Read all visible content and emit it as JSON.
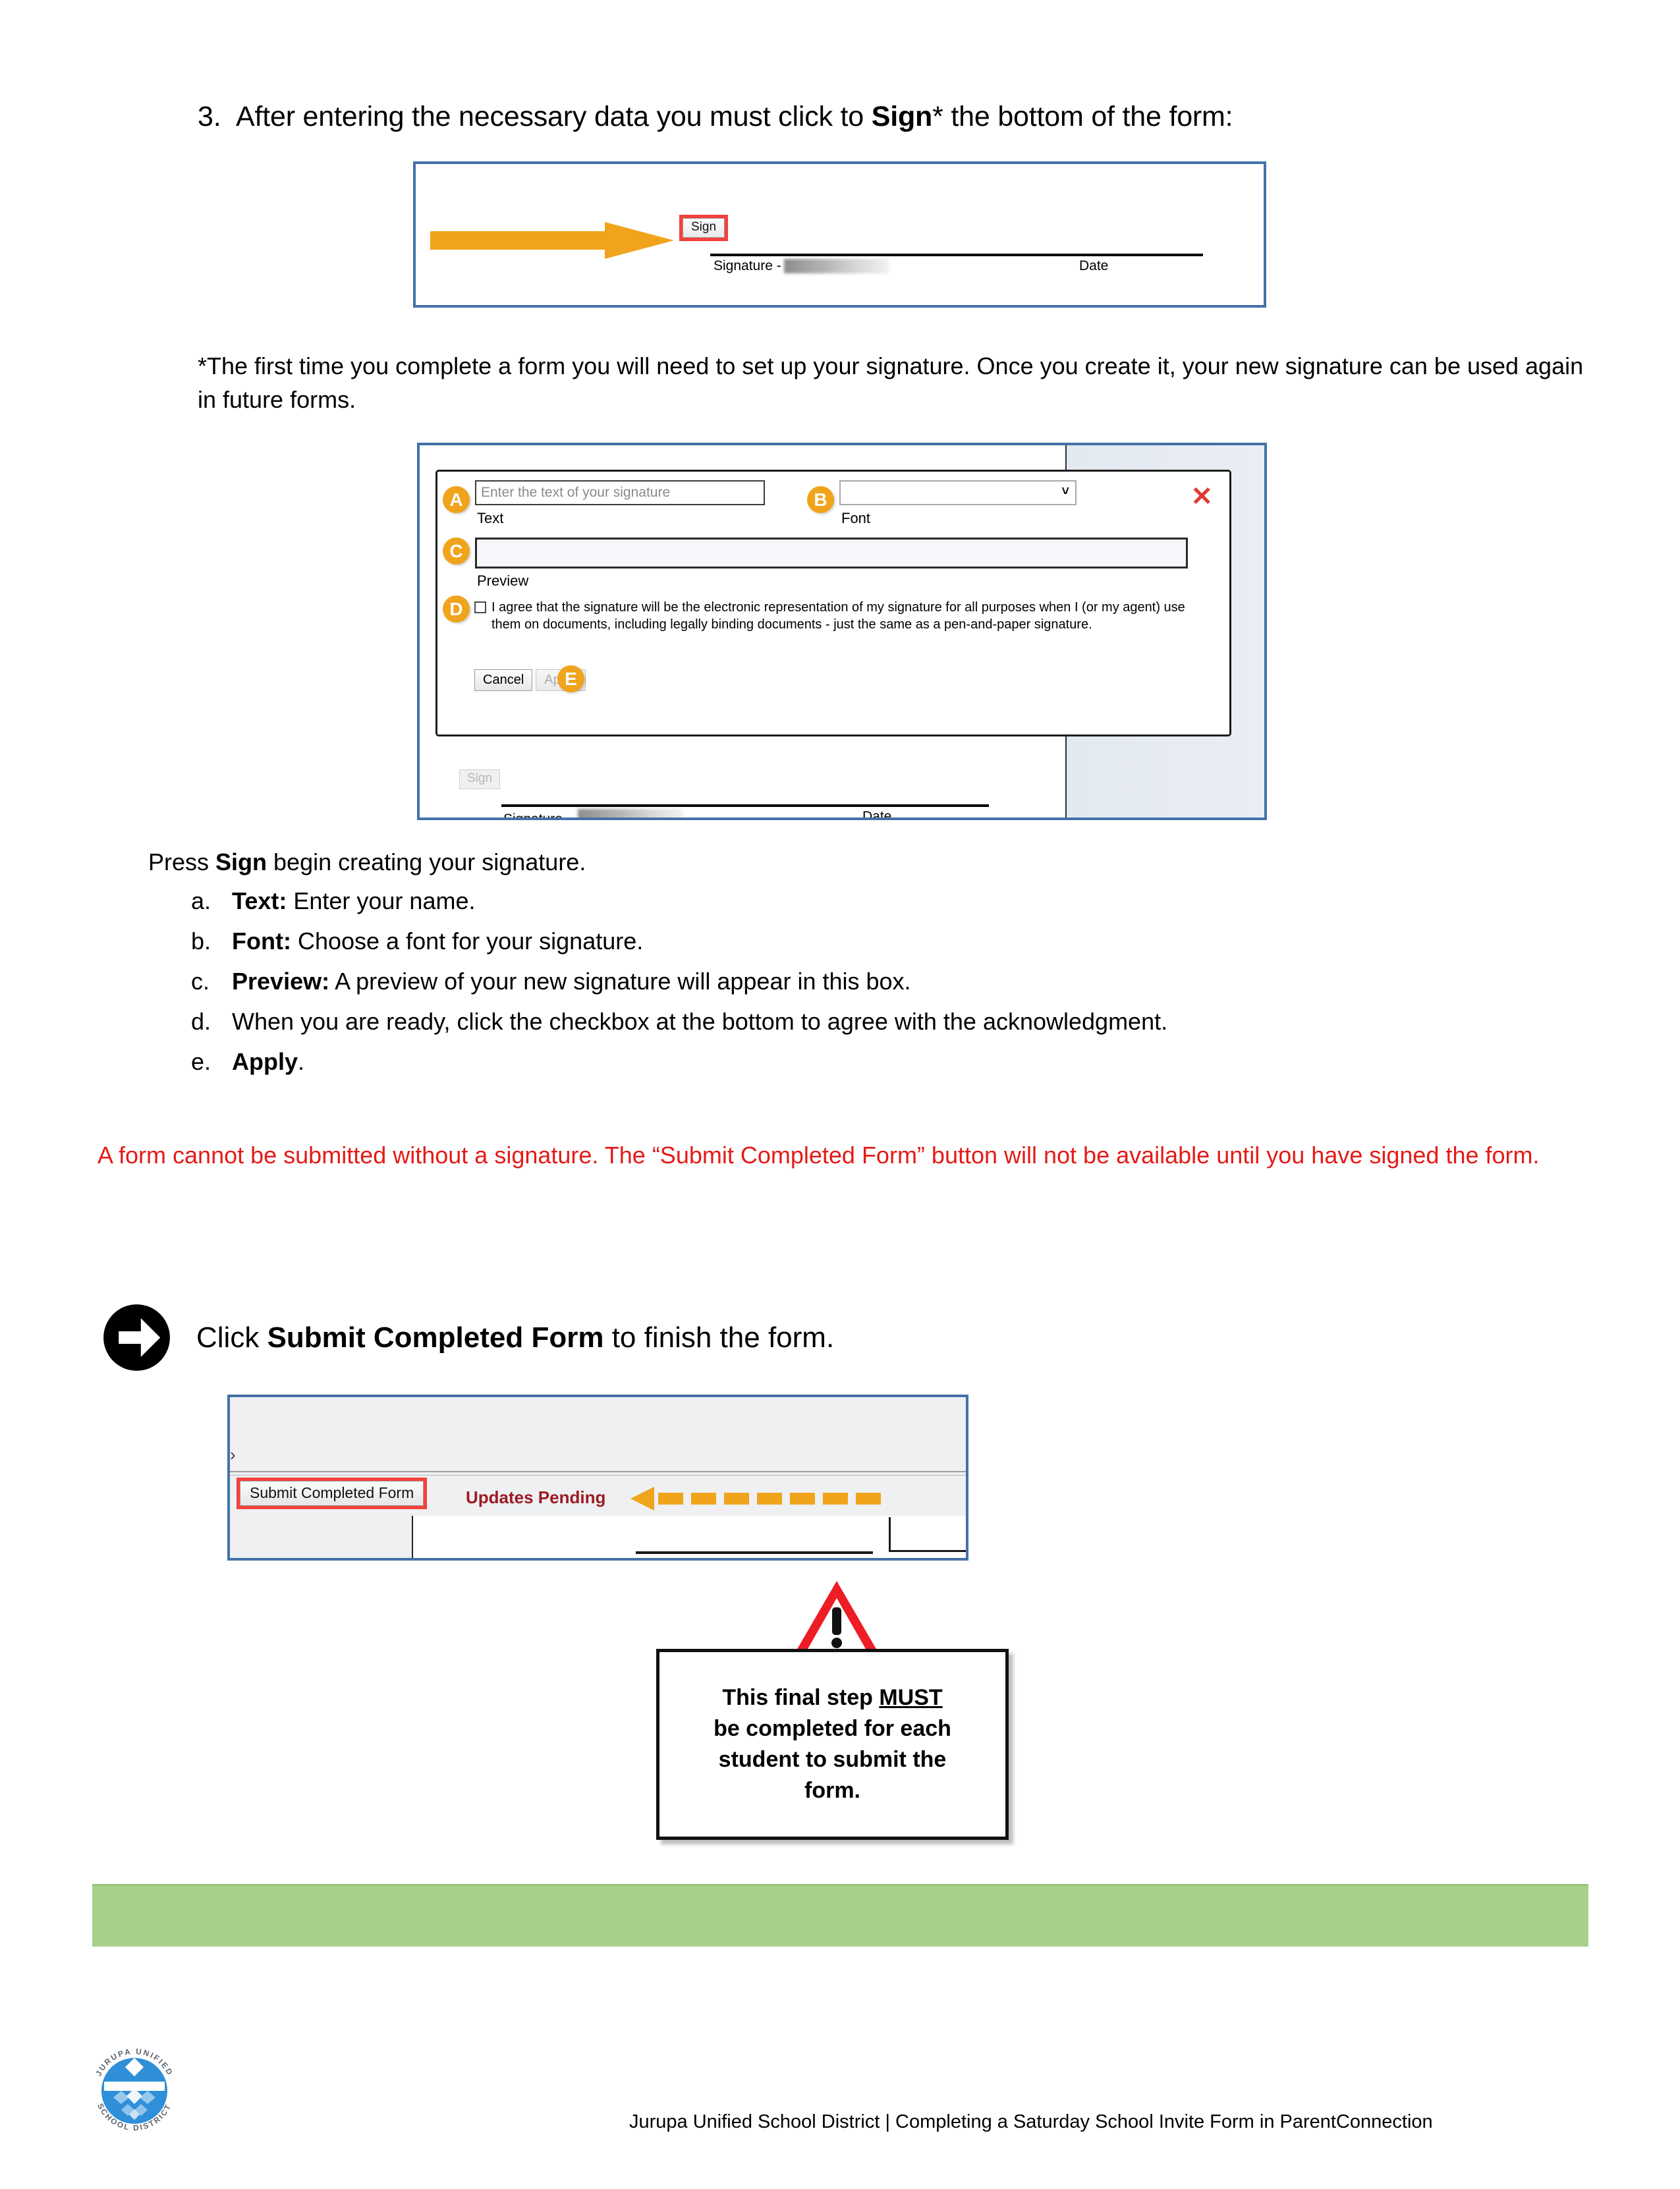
{
  "step": {
    "number": "3.",
    "text_before": "After entering the necessary data you must click to ",
    "bold": "Sign",
    "text_after": "* the bottom of the form:"
  },
  "figure_sign": {
    "sign_button_label": "Sign",
    "signature_label": "Signature -",
    "date_label": "Date",
    "arrow_color": "#f0a41c",
    "highlight_color": "#f4413c",
    "border_color": "#4472a8"
  },
  "footnote": "*The first time you complete a form you will need to set up your signature. Once you create it, your new signature can be used again in future forms.",
  "signature_dialog": {
    "close_icon": "✕",
    "markers": {
      "a": "A",
      "b": "B",
      "c": "C",
      "d": "D",
      "e": "E"
    },
    "text_input_placeholder": "Enter the text of your signature",
    "text_label": "Text",
    "font_label": "Font",
    "font_value": "",
    "preview_label": "Preview",
    "preview_value": "",
    "acknowledgment": "I agree that the signature will be the electronic representation of my signature for all purposes when I (or my agent) use them on documents, including legally binding documents - just the same as a pen-and-paper signature.",
    "cancel_label": "Cancel",
    "apply_label": "Apply",
    "sign_button_label": "Sign",
    "signature_label": "Signature -",
    "date_label": "Date"
  },
  "press_sign": {
    "lead_before": "Press ",
    "lead_bold": "Sign",
    "lead_after": " begin creating your signature.",
    "items": [
      {
        "marker": "a.",
        "bold": "Text:",
        "text": " Enter your name."
      },
      {
        "marker": "b.",
        "bold": "Font:",
        "text": " Choose a font for your signature."
      },
      {
        "marker": "c.",
        "bold": "Preview:",
        "text": " A preview of your new signature will appear in this box."
      },
      {
        "marker": "d.",
        "bold": "",
        "text": "When you are ready, click the checkbox at the bottom to agree with the acknowledgment."
      },
      {
        "marker": "e.",
        "bold": "Apply",
        "text": "."
      }
    ]
  },
  "warning_red": {
    "text": "A form cannot be submitted without a signature. The “Submit Completed Form” button will not be available until you have signed the form.",
    "color": "#e31b17"
  },
  "submit_section": {
    "heading_before": "Click ",
    "heading_bold": "Submit Completed Form",
    "heading_after": " to finish the form.",
    "arrow_icon": "circle-right-arrow-icon"
  },
  "figure_submit": {
    "submit_button_label": "Submit Completed Form",
    "updates_pending_label": "Updates Pending",
    "updates_pending_color": "#9d1a22",
    "highlight_color": "#f4413c",
    "dashed_arrow_color": "#f0a41c",
    "border_color": "#4472a8"
  },
  "callout": {
    "warning_icon": "warning-triangle-icon",
    "line1_before": "This final step ",
    "line1_underline": "MUST",
    "line2": "be completed for each",
    "line3": "student to submit the",
    "line4": "form."
  },
  "green_bar": {
    "color": "#a8cf8c"
  },
  "footer": {
    "logo_top_text": "JURUPA UNIFIED",
    "logo_bottom_text": "SCHOOL DISTRICT",
    "text": "Jurupa Unified School District | Completing a Saturday School Invite Form in ParentConnection"
  }
}
